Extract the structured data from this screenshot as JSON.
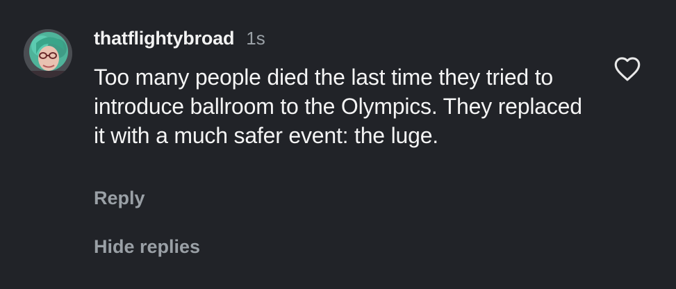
{
  "comment": {
    "username": "thatflightybroad",
    "timestamp": "1s",
    "text": "Too many people died the last time they tried to introduce ballroom to the Olympics. They replaced it with a much safer event: the luge.",
    "reply_label": "Reply",
    "hide_replies_label": "Hide replies",
    "like_icon": "heart-outline-icon",
    "avatar_icon": "user-avatar"
  },
  "colors": {
    "background": "#212328",
    "username": "#f2f2f2",
    "muted": "#9aa0a6",
    "text": "#f4f4f4"
  }
}
